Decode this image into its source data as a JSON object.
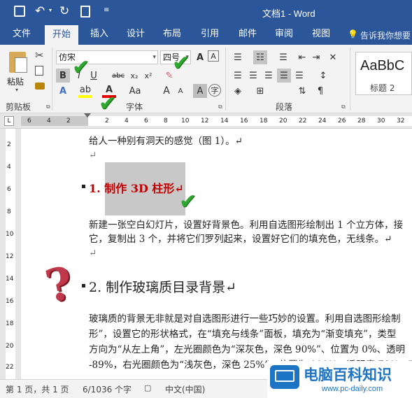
{
  "titlebar": {
    "title": "文档1 - Word"
  },
  "tabs": [
    {
      "label": "文件"
    },
    {
      "label": "开始"
    },
    {
      "label": "插入"
    },
    {
      "label": "设计"
    },
    {
      "label": "布局"
    },
    {
      "label": "引用"
    },
    {
      "label": "邮件"
    },
    {
      "label": "审阅"
    },
    {
      "label": "视图"
    }
  ],
  "tell_me": "告诉我你想要",
  "ribbon": {
    "paste_label": "粘贴",
    "font_name": "仿宋",
    "font_size": "四号",
    "bold": "B",
    "italic": "I",
    "underline": "U",
    "strike": "abc",
    "subscript": "x₂",
    "superscript": "x²",
    "font_color_letter": "A",
    "case": "Aa",
    "grow": "A",
    "shrink": "A",
    "char_shade": "A",
    "phonetic": "字",
    "enclose": "㊥",
    "style_preview": "AaBbC",
    "style_name": "标题 2",
    "groups": {
      "clipboard": "剪贴板",
      "font": "字体",
      "paragraph": "段落"
    }
  },
  "ruler": {
    "ticks": [
      "6",
      "4",
      "2",
      "2",
      "4",
      "6",
      "8",
      "10",
      "12",
      "14",
      "16",
      "18",
      "20",
      "22",
      "24",
      "26",
      "28",
      "30",
      "32"
    ]
  },
  "vruler": {
    "ticks": [
      "2",
      "4",
      "6",
      "8",
      "10",
      "12",
      "14",
      "16",
      "18",
      "20",
      "22"
    ]
  },
  "document": {
    "line1": "给人一种别有洞天的感觉（图 1）。↵",
    "heading1": "1.  制作 3D 柱形↵",
    "para1_l1": "新建一张空白幻灯片，设置好背景色。利用自选图形绘制出 1 个立方体，接",
    "para1_l2": "它，复制出 3 个，并将它们罗列起来，设置好它们的填充色，无线条。↵",
    "heading2": "2. 制作玻璃质目录背景↵",
    "para2_l1": "玻璃质的背景无非就是对自选图形进行一些巧妙的设置。利用自选图形绘制",
    "para2_l2": "形”，设置它的形状格式，在“填充与线条”面板，填充为“渐变填充”，类型",
    "para2_l3": "方向为“从左上角”，左光圈颜色为“深灰色，深色 90%”、位置为 0%、透明",
    "para2_l4": "-89%，右光圈颜色为“浅灰色，深色 25%”，位置为 100%，透明度 78%，亮度 -",
    "return_mark": "↵"
  },
  "status": {
    "page": "第 1 页，共 1 页",
    "words": "6/1036 个字",
    "lang": "中文(中国)"
  },
  "watermark": {
    "name": "电脑百科知识",
    "url": "www.pc-daily.com"
  },
  "colors": {
    "word_blue": "#2b579a",
    "heading_red": "#c00000",
    "selection_gray": "#c8c8c8",
    "check_green": "#2ea82e"
  }
}
